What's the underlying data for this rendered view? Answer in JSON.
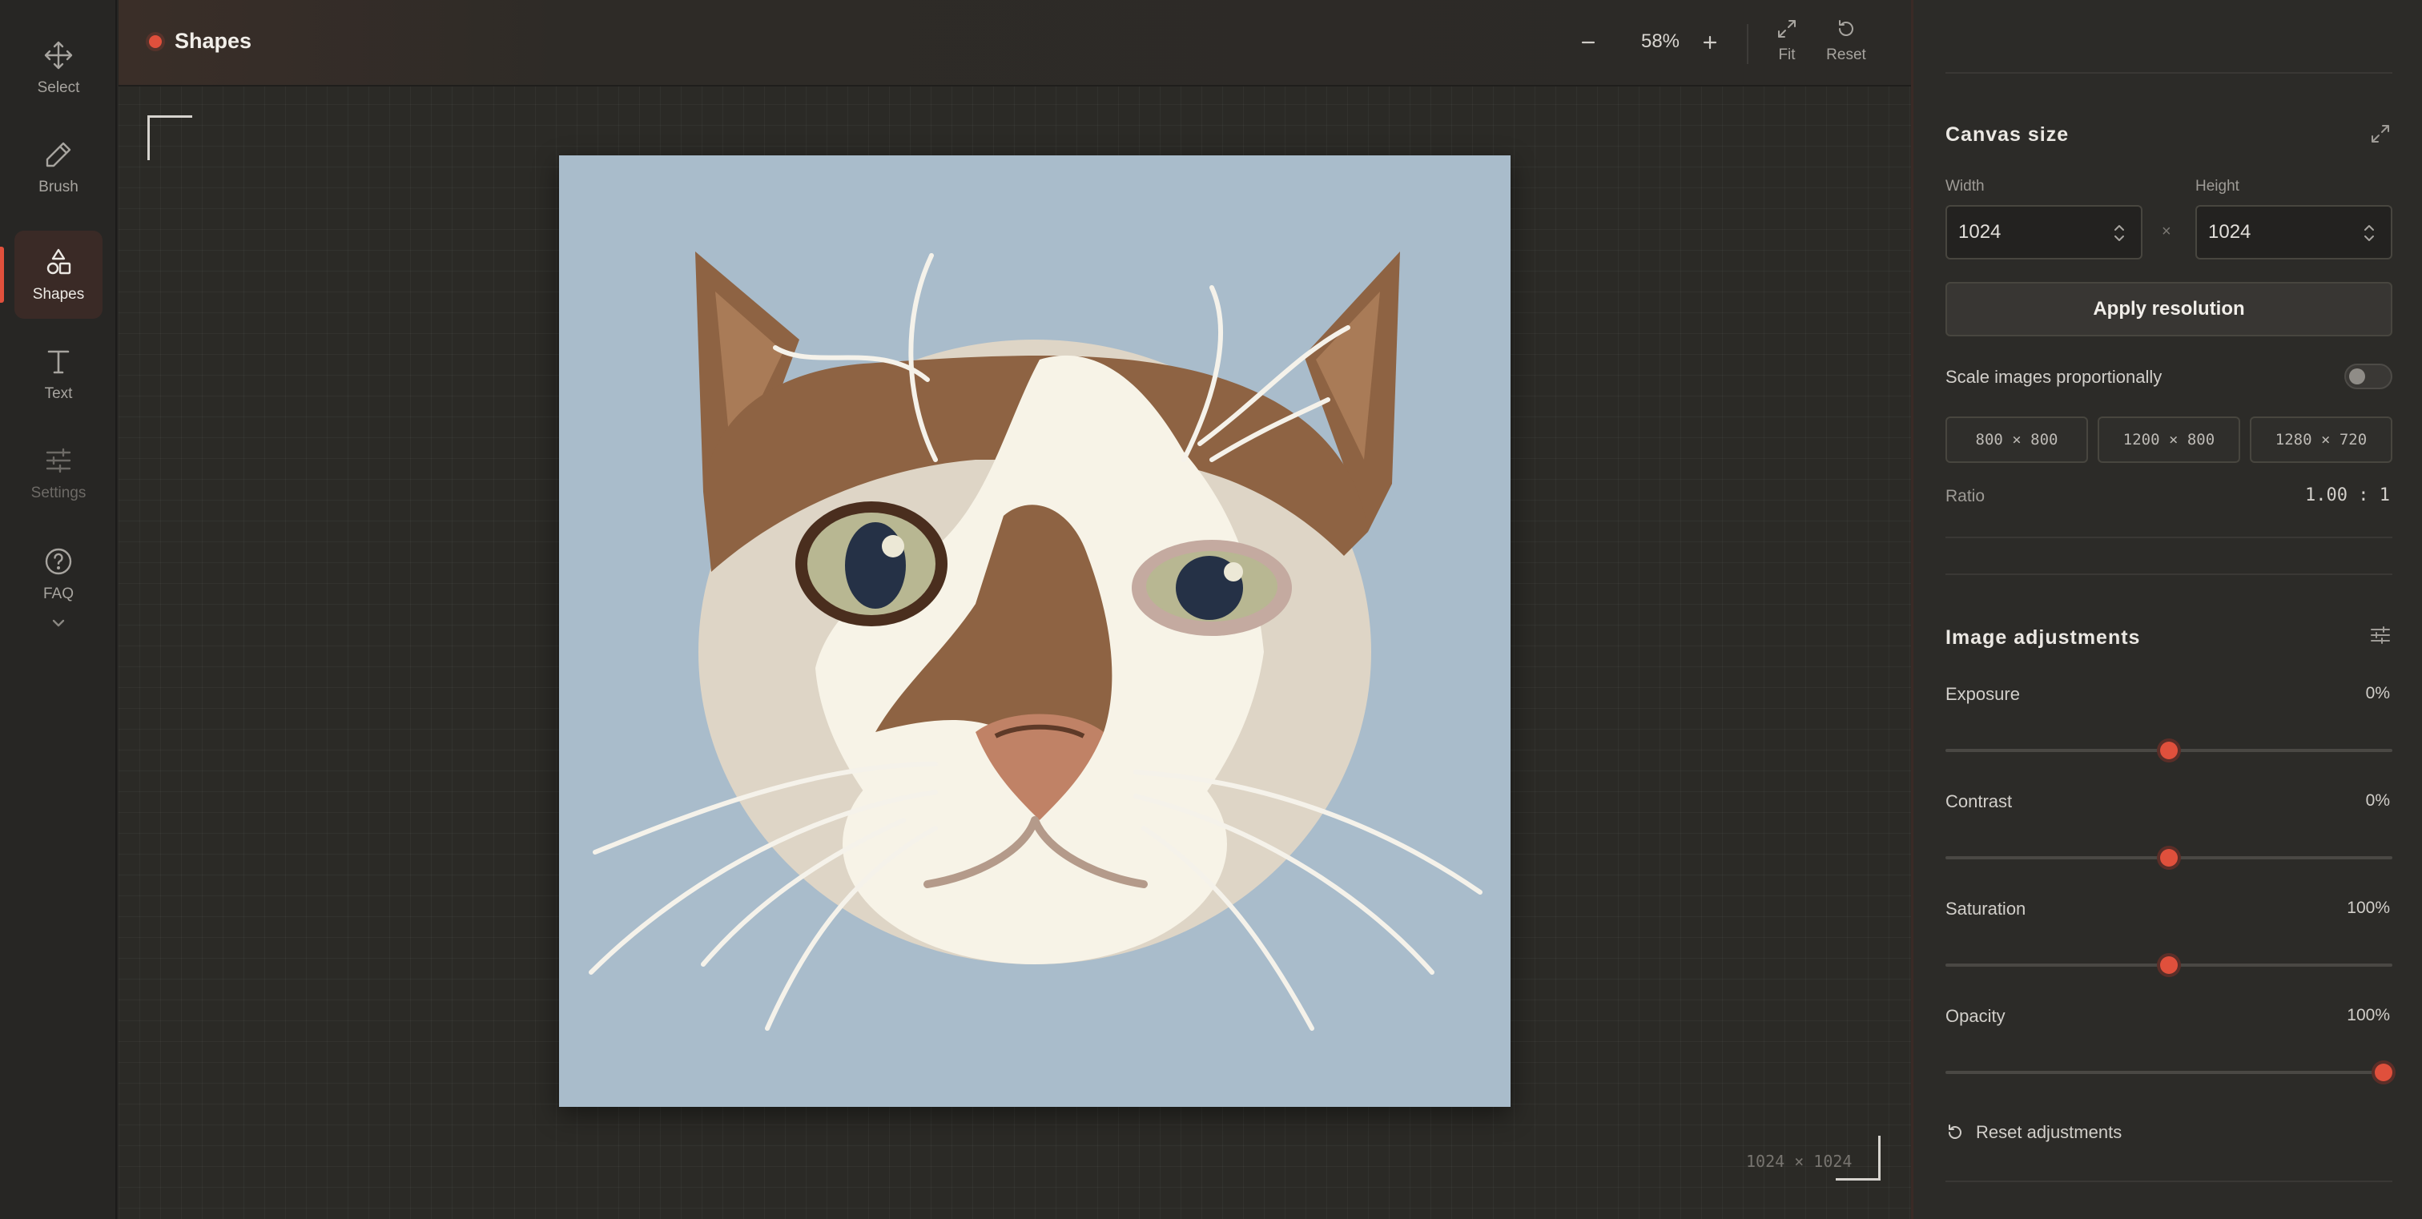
{
  "toolbar": {
    "tools": [
      {
        "label": "Select",
        "icon": "move-icon"
      },
      {
        "label": "Brush",
        "icon": "pencil-icon"
      },
      {
        "label": "Shapes",
        "icon": "shapes-icon",
        "active": true
      },
      {
        "label": "Text",
        "icon": "text-icon"
      },
      {
        "label": "Settings",
        "icon": "sliders-icon",
        "disabled": true
      },
      {
        "label": "FAQ",
        "icon": "help-circle-icon"
      }
    ]
  },
  "topbar": {
    "title": "Shapes",
    "zoom": "58%",
    "fit_label": "Fit",
    "reset_label": "Reset"
  },
  "canvas": {
    "dimensions": "1024 × 1024",
    "background_color": "#a9bccb"
  },
  "panel": {
    "canvas_size": {
      "title": "Canvas size",
      "width_label": "Width",
      "height_label": "Height",
      "width_value": "1024",
      "height_value": "1024",
      "times": "×",
      "apply_label": "Apply resolution",
      "scale_label": "Scale images proportionally",
      "presets": [
        "800 × 800",
        "1200 × 800",
        "1280 × 720"
      ],
      "ratio_label": "Ratio",
      "ratio_value": "1.00 : 1"
    },
    "image_adjustments": {
      "title": "Image adjustments",
      "items": [
        {
          "name": "Exposure",
          "value": "0%",
          "fraction": 0.5
        },
        {
          "name": "Contrast",
          "value": "0%",
          "fraction": 0.5
        },
        {
          "name": "Saturation",
          "value": "100%",
          "fraction": 0.5
        },
        {
          "name": "Opacity",
          "value": "100%",
          "fraction": 0.98
        }
      ],
      "reset_label": "Reset adjustments"
    }
  },
  "colors": {
    "accent": "#e0503c",
    "panel_bg": "#2c2b28",
    "workspace_bg": "#2b2a26"
  }
}
